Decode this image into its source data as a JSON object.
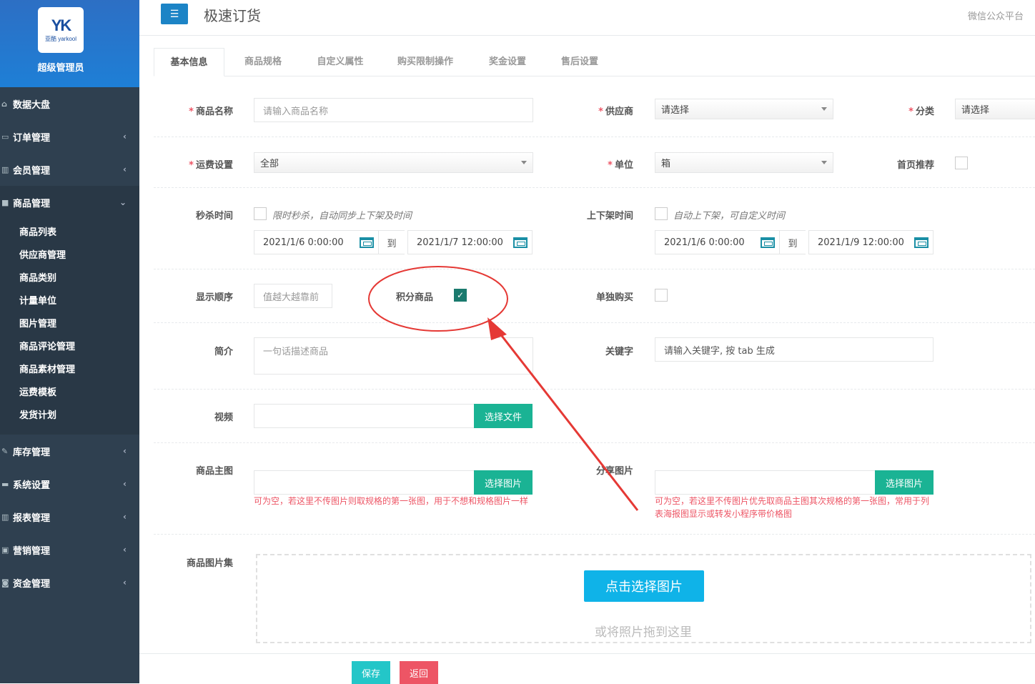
{
  "sidebar": {
    "logo_mark": "YK",
    "logo_text": "亚酷 yarkool",
    "admin_name": "超级管理员",
    "items": [
      {
        "label": "数据大盘",
        "icon": "home-icon",
        "glyph": "⌂",
        "arrow": ""
      },
      {
        "label": "订单管理",
        "icon": "list-icon",
        "glyph": "▭",
        "arrow": "‹"
      },
      {
        "label": "会员管理",
        "icon": "bar-chart-icon",
        "glyph": "▥",
        "arrow": "‹"
      },
      {
        "label": "商品管理",
        "icon": "cube-icon",
        "glyph": "■",
        "arrow": "⌄"
      },
      {
        "label": "库存管理",
        "icon": "edit-icon",
        "glyph": "✎",
        "arrow": "‹"
      },
      {
        "label": "系统设置",
        "icon": "desktop-icon",
        "glyph": "▬",
        "arrow": "‹"
      },
      {
        "label": "报表管理",
        "icon": "bar-chart-icon",
        "glyph": "▥",
        "arrow": "‹"
      },
      {
        "label": "营销管理",
        "icon": "tag-icon",
        "glyph": "▣",
        "arrow": "‹"
      },
      {
        "label": "资金管理",
        "icon": "money-icon",
        "glyph": "◙",
        "arrow": "‹"
      }
    ],
    "sub_items": [
      "商品列表",
      "供应商管理",
      "商品类别",
      "计量单位",
      "图片管理",
      "商品评论管理",
      "商品素材管理",
      "运费模板",
      "发货计划"
    ]
  },
  "header": {
    "menu_glyph": "☰",
    "title": "极速订货",
    "wechat": "微信公众平台"
  },
  "tabs": [
    "基本信息",
    "商品规格",
    "自定义属性",
    "购买限制操作",
    "奖金设置",
    "售后设置"
  ],
  "form": {
    "name_label": "商品名称",
    "name_placeholder": "请输入商品名称",
    "supplier_label": "供应商",
    "supplier_value": "请选择",
    "category_label": "分类",
    "category_value": "请选择",
    "shipping_label": "运费设置",
    "shipping_value": "全部",
    "unit_label": "单位",
    "unit_value": "箱",
    "home_rec_label": "首页推荐",
    "flash_label": "秒杀时间",
    "flash_hint": "限时秒杀，自动同步上下架及时间",
    "flash_start": "2021/1/6 0:00:00",
    "flash_end": "2021/1/7 12:00:00",
    "to_text": "到",
    "shelf_label": "上下架时间",
    "shelf_hint": "自动上下架，可自定义时间",
    "shelf_start": "2021/1/6 0:00:00",
    "shelf_end": "2021/1/9 12:00:00",
    "order_label": "显示顺序",
    "order_placeholder": "值越大越靠前",
    "points_label": "积分商品",
    "single_buy_label": "单独购买",
    "intro_label": "简介",
    "intro_placeholder": "一句话描述商品",
    "keyword_label": "关键字",
    "keyword_placeholder": "请输入关键字, 按 tab 生成",
    "video_label": "视频",
    "choose_file": "选择文件",
    "main_img_label": "商品主图",
    "share_img_label": "分享图片",
    "choose_image": "选择图片",
    "main_img_note": "可为空，若这里不传图片则取规格的第一张图，用于不想和规格图片一样",
    "share_img_note": "可为空，若这里不传图片优先取商品主图其次规格的第一张图，常用于列表海报图显示或转发小程序带价格图",
    "gallery_label": "商品图片集",
    "pick_button": "点击选择图片",
    "drop_text": "或将照片拖到这里"
  },
  "actions": {
    "save": "保存",
    "back": "返回"
  },
  "colors": {
    "sidebar": "#2f4050",
    "primary": "#1c84c6",
    "green": "#1ab394",
    "red": "#ed5565",
    "annotation": "#e53935"
  }
}
